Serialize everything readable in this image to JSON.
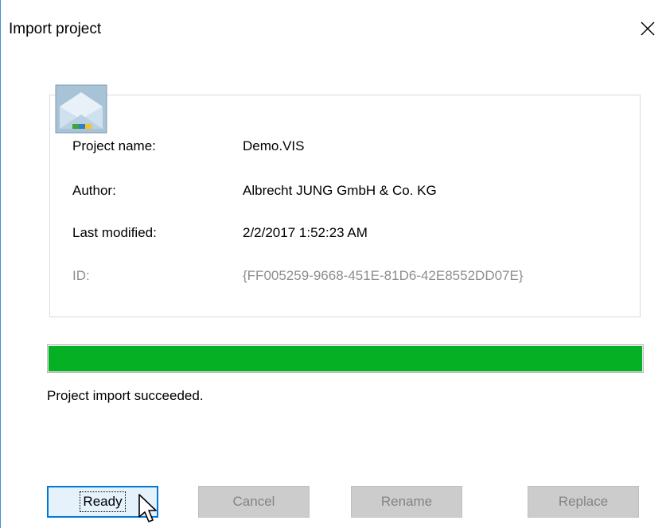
{
  "window": {
    "title": "Import project",
    "close_glyph": "✕"
  },
  "project": {
    "icon": "project-package-icon",
    "name_label": "Project name:",
    "name_value": "Demo.VIS",
    "author_label": "Author:",
    "author_value": "Albrecht JUNG GmbH & Co. KG",
    "modified_label": "Last modified:",
    "modified_value": "2/2/2017 1:52:23 AM",
    "id_label": "ID:",
    "id_value": "{FF005259-9668-451E-81D6-42E8552DD07E}"
  },
  "progress": {
    "percent": 100,
    "color": "#06b025"
  },
  "status": {
    "message": "Project import succeeded."
  },
  "buttons": {
    "ready": "Ready",
    "cancel": "Cancel",
    "rename": "Rename",
    "replace": "Replace"
  },
  "colors": {
    "accent": "#0078d7",
    "window_border": "#4a8fd8"
  }
}
